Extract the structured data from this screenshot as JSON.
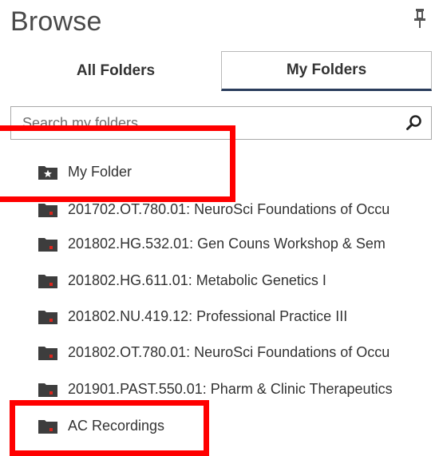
{
  "header": {
    "title": "Browse",
    "pin_icon": "pin-icon"
  },
  "tabs": [
    {
      "label": "All Folders",
      "selected": false
    },
    {
      "label": "My Folders",
      "selected": true
    }
  ],
  "search": {
    "placeholder": "Search my folders",
    "icon": "search-icon"
  },
  "folders": [
    {
      "label": "My Folder",
      "icon": "folder-star-icon"
    },
    {
      "label": "201702.OT.780.01: NeuroSci Foundations of Occu",
      "icon": "folder-icon"
    },
    {
      "label": "201802.HG.532.01: Gen Couns Workshop & Sem",
      "icon": "folder-icon"
    },
    {
      "label": "201802.HG.611.01: Metabolic Genetics I",
      "icon": "folder-icon"
    },
    {
      "label": "201802.NU.419.12: Professional Practice III",
      "icon": "folder-icon"
    },
    {
      "label": "201802.OT.780.01: NeuroSci Foundations of Occu",
      "icon": "folder-icon"
    },
    {
      "label": "201901.PAST.550.01: Pharm & Clinic Therapeutics",
      "icon": "folder-icon"
    },
    {
      "label": "AC Recordings",
      "icon": "folder-icon"
    }
  ],
  "colors": {
    "folder": "#3d3d3d",
    "folder_dot": "#d9251c",
    "highlight": "#ff0000",
    "tab_active_border": "#2a3d5c"
  }
}
